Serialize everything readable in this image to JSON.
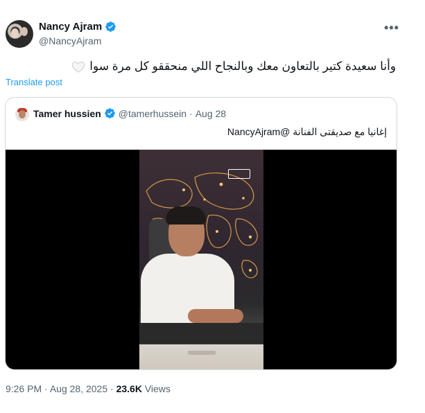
{
  "author": {
    "name": "Nancy Ajram",
    "handle": "@NancyAjram"
  },
  "tweet": {
    "text": "وأنا سعيدة كتير بالتعاون معك وبالنجاح اللي منحققو كل مرة سوا",
    "emoji": "white-heart-emoji",
    "translate_label": "Translate post"
  },
  "quoted": {
    "name": "Tamer hussien",
    "handle": "@tamerhussein",
    "separator": "·",
    "date": "Aug 28",
    "text": "إغانيا مع صديقتى الفنانة @NancyAjram",
    "media": "video-thumbnail"
  },
  "footer": {
    "time": "9:26 PM",
    "dot1": "·",
    "date": "Aug 28, 2025",
    "dot2": "·",
    "views_count": "23.6K",
    "views_label": "Views"
  },
  "icons": {
    "verified": "verified-badge-icon",
    "more": "more-options-icon"
  },
  "colors": {
    "accent": "#1d9bf0",
    "text": "#0f1419",
    "secondary": "#536471",
    "border": "#cfd9de"
  }
}
